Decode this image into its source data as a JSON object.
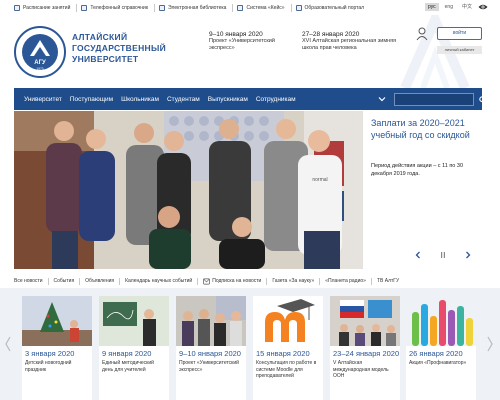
{
  "topbar": {
    "links": [
      {
        "label": "Расписание занятий",
        "icon": "calendar-icon"
      },
      {
        "label": "Телефонный справочник",
        "icon": "phone-icon"
      },
      {
        "label": "Электронная библиотека",
        "icon": "book-icon"
      },
      {
        "label": "Система «Кейс»",
        "icon": "case-icon"
      },
      {
        "label": "Образовательный портал",
        "icon": "portal-icon"
      }
    ],
    "languages": [
      "рус",
      "eng",
      "中文"
    ],
    "active_language": "рус",
    "accessibility_icon": "eye-icon"
  },
  "header": {
    "title_lines": [
      "АЛТАЙСКИЙ",
      "ГОСУДАРСТВЕННЫЙ",
      "УНИВЕРСИТЕТ"
    ],
    "logo_text": "АГУ",
    "logo_year": "1973",
    "events": [
      {
        "date": "9–10 января 2020",
        "text": "Проект «Университетский экспресс»"
      },
      {
        "date": "27–28 января 2020",
        "text": "XVI Алтайская региональная зимняя школа прав человека"
      }
    ],
    "login_label": "войти",
    "cabinet_label": "личный кабинет"
  },
  "nav": {
    "items": [
      "Университет",
      "Поступающим",
      "Школьникам",
      "Студентам",
      "Выпускникам",
      "Сотрудникам"
    ],
    "search_placeholder": ""
  },
  "hero": {
    "promo_title": "Заплати за 2020–2021 учебный год со скидкой",
    "promo_text": "Период действия акции – с 11 по 30 декабря 2019 года.",
    "shirt_text": "normal"
  },
  "tabs": [
    "Все новости",
    "События",
    "Объявления",
    "Календарь научных событий",
    "Подписка на новости",
    "Газета «За науку»",
    "«Планета радио»",
    "ТВ АлтГУ"
  ],
  "news": [
    {
      "date": "3 января 2020",
      "text": "Детский новогодний праздник"
    },
    {
      "date": "9 января 2020",
      "text": "Единый методический день для учителей"
    },
    {
      "date": "9–10 января 2020",
      "text": "Проект «Университетский экспресс»"
    },
    {
      "date": "15 января 2020",
      "text": "Консультация по работе в системе Moodle для преподавателей"
    },
    {
      "date": "23–24 января 2020",
      "text": "V Алтайская международная модель ООН"
    },
    {
      "date": "26 января 2020",
      "text": "Акция «Профнавигатор»"
    }
  ],
  "colors": {
    "brand": "#2b5797",
    "nav": "#1f4d8c",
    "news_bg": "#eef1f6"
  }
}
